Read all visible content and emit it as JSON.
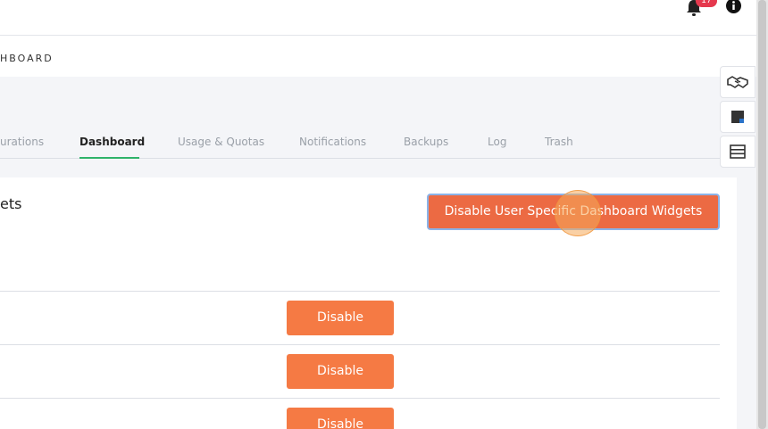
{
  "header": {
    "notification_count": "17",
    "bell_icon": "bell-icon",
    "info_icon": "info-icon"
  },
  "breadcrumb": "HBOARD",
  "tabs": [
    {
      "label": "urations"
    },
    {
      "label": "Dashboard",
      "active": true
    },
    {
      "label": "Usage & Quotas"
    },
    {
      "label": "Notifications"
    },
    {
      "label": "Backups"
    },
    {
      "label": "Log"
    },
    {
      "label": "Trash"
    }
  ],
  "panel": {
    "title": "ets",
    "primary_button_label": "Disable User Specific Dashboard Widgets",
    "rows": [
      {
        "button_label": "Disable"
      },
      {
        "button_label": "Disable"
      },
      {
        "button_label": "Disable"
      }
    ]
  },
  "side_tools": [
    {
      "icon": "handshake-icon"
    },
    {
      "icon": "sticky-note-icon"
    },
    {
      "icon": "list-icon"
    }
  ],
  "colors": {
    "accent_orange": "#f57a44",
    "tab_active_underline": "#2fb36a",
    "badge_red": "#e5394e"
  }
}
